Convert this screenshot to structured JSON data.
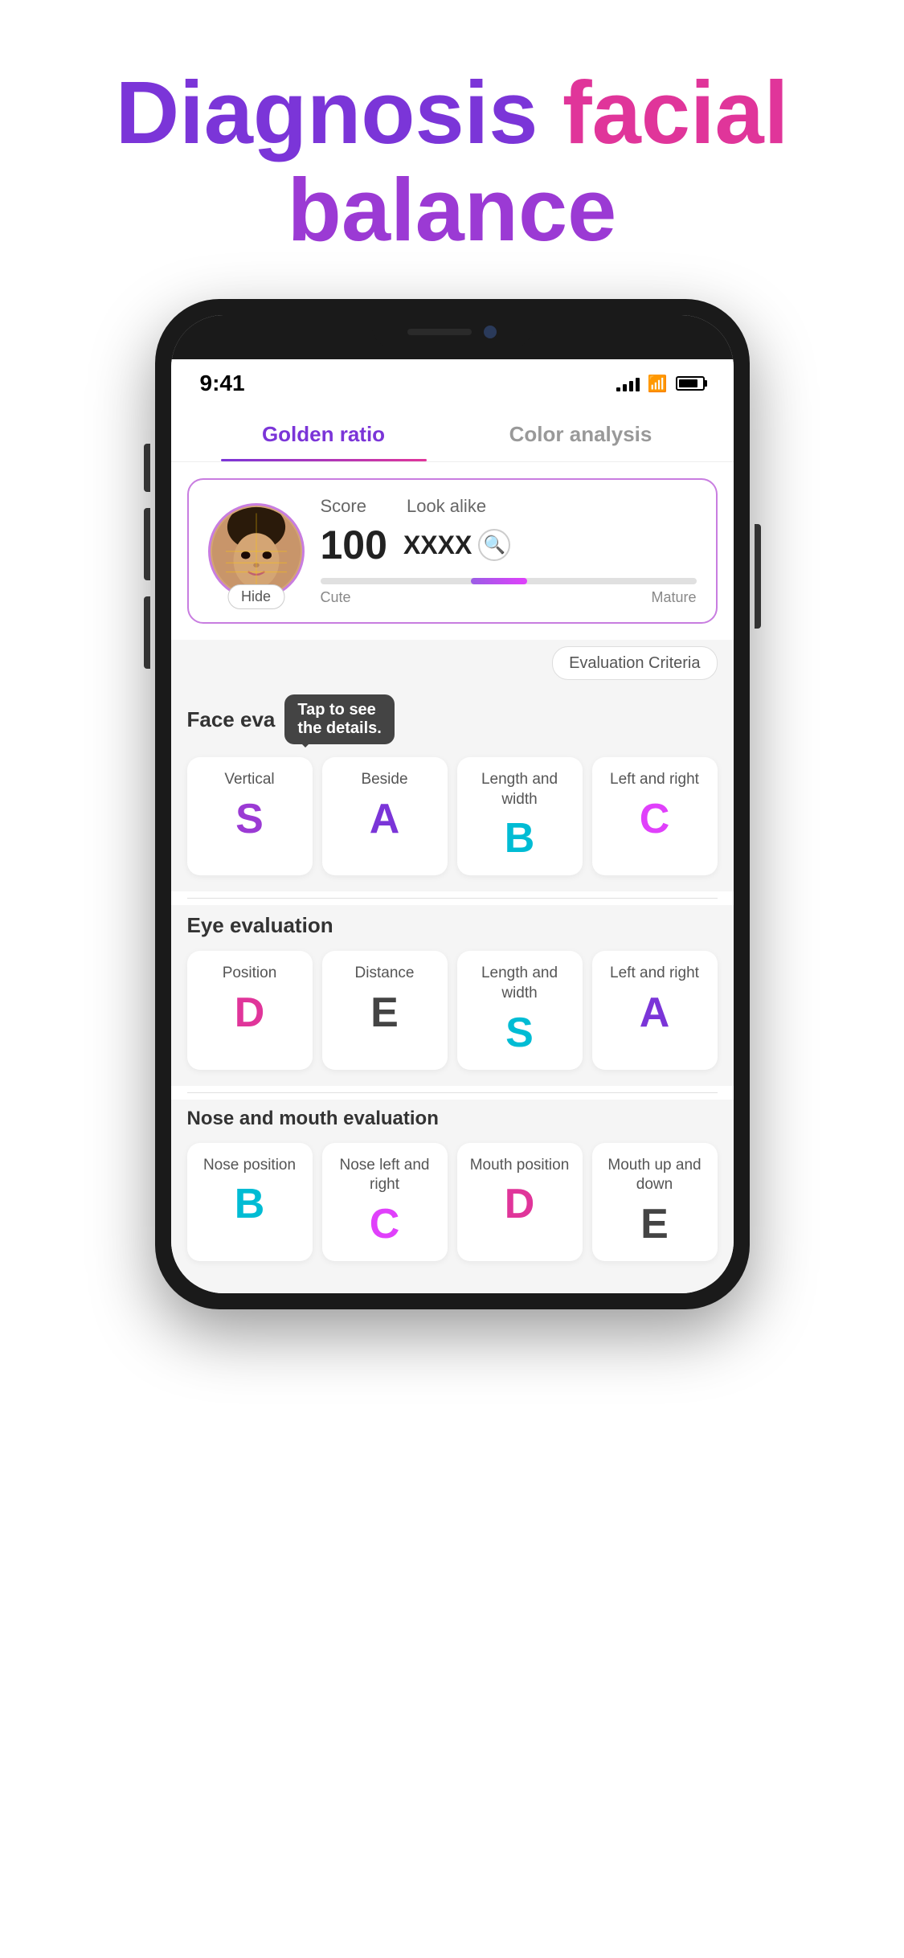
{
  "title": {
    "line1_part1": "Diagnosis ",
    "line1_part2": "facial",
    "line2": "balance"
  },
  "phone": {
    "status_bar": {
      "time": "9:41",
      "signal": "4 bars",
      "wifi": "on",
      "battery": "full"
    },
    "tabs": [
      {
        "id": "golden-ratio",
        "label": "Golden ratio",
        "active": true
      },
      {
        "id": "color-analysis",
        "label": "Color analysis",
        "active": false
      }
    ],
    "score_card": {
      "score_label": "Score",
      "score_value": "100",
      "lookalike_label": "Look alike",
      "lookalike_value": "XXXX",
      "hide_label": "Hide",
      "slider_left": "Cute",
      "slider_right": "Mature"
    },
    "eval_criteria_label": "Evaluation\nCriteria",
    "face_evaluation": {
      "title": "Face eva",
      "tooltip": "Tap to see\nthe details.",
      "grades": [
        {
          "label": "Vertical",
          "letter": "S",
          "color_class": "grade-s"
        },
        {
          "label": "Beside",
          "letter": "A",
          "color_class": "grade-a"
        },
        {
          "label": "Length and width",
          "letter": "B",
          "color_class": "grade-b"
        },
        {
          "label": "Left and right",
          "letter": "C",
          "color_class": "grade-c"
        }
      ]
    },
    "eye_evaluation": {
      "title": "Eye evaluation",
      "grades": [
        {
          "label": "Position",
          "letter": "D",
          "color_class": "grade-d"
        },
        {
          "label": "Distance",
          "letter": "E",
          "color_class": "grade-e"
        },
        {
          "label": "Length and width",
          "letter": "S",
          "color_class": "grade-b"
        },
        {
          "label": "Left and right",
          "letter": "A",
          "color_class": "grade-a"
        }
      ]
    },
    "nose_mouth_evaluation": {
      "title": "Nose and mouth evaluation",
      "grades": [
        {
          "label": "Nose position",
          "letter": "B",
          "color_class": "grade-b"
        },
        {
          "label": "Nose left and right",
          "letter": "C",
          "color_class": "grade-c"
        },
        {
          "label": "Mouth position",
          "letter": "D",
          "color_class": "grade-d"
        },
        {
          "label": "Mouth up and down",
          "letter": "E",
          "color_class": "grade-e"
        }
      ]
    }
  }
}
